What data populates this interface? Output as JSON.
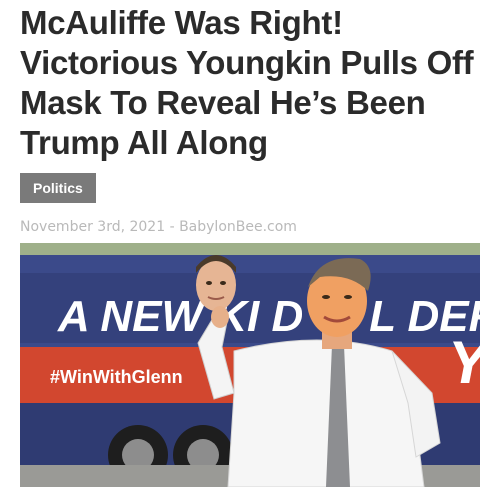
{
  "article": {
    "headline": "McAuliffe Was Right! Victorious Youngkin Pulls Off Mask To Reveal He’s Been Trump All Along",
    "category": "Politics",
    "meta": {
      "date": "November 3rd, 2021",
      "separator": " - ",
      "source": "BabylonBee.com"
    }
  },
  "image": {
    "bus_slogan": "A NEW KI D of L DER",
    "bus_hashtag": "#WinWithGlenn"
  },
  "colors": {
    "headline": "#2b2b2b",
    "tag_bg": "#7a7a7a",
    "meta": "#b9b9b9",
    "bus_blue": "#3b4a8a",
    "bus_red": "#d2472f"
  }
}
